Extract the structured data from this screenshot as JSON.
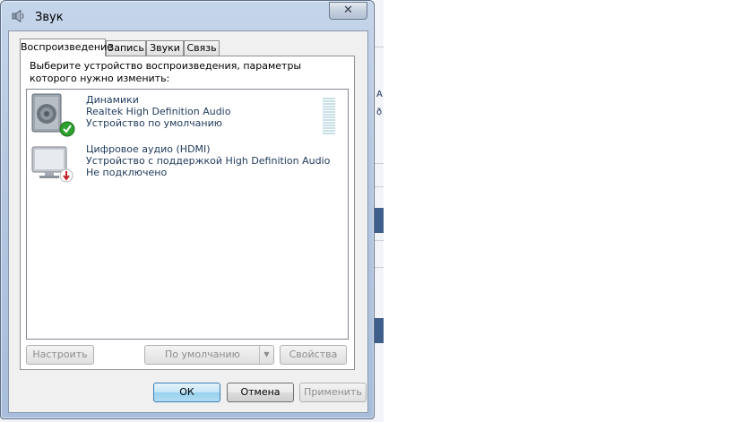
{
  "window": {
    "title": "Звук",
    "close_symbol": "✕"
  },
  "tabs": [
    {
      "label": "Воспроизведение",
      "active": true
    },
    {
      "label": "Запись",
      "active": false
    },
    {
      "label": "Звуки",
      "active": false
    },
    {
      "label": "Связь",
      "active": false
    }
  ],
  "prompt": "Выберите устройство воспроизведения, параметры которого нужно изменить:",
  "devices": [
    {
      "name": "Динамики",
      "driver": "Realtek High Definition Audio",
      "status": "Устройство по умолчанию",
      "icon": "speaker-icon",
      "badge": "default-check-icon"
    },
    {
      "name": "Цифровое аудио (HDMI)",
      "driver": "Устройство с поддержкой High Definition Audio",
      "status": "Не подключено",
      "icon": "monitor-icon",
      "badge": "disconnected-arrow-icon"
    }
  ],
  "panel_buttons": {
    "configure": "Настроить",
    "set_default": "По умолчанию",
    "properties": "Свойства"
  },
  "dialog_buttons": {
    "ok": "ОК",
    "cancel": "Отмена",
    "apply": "Применить"
  },
  "colors": {
    "device_text": "#1e395b",
    "check_green": "#2ea02e",
    "disconnect_red": "#c0262a"
  }
}
